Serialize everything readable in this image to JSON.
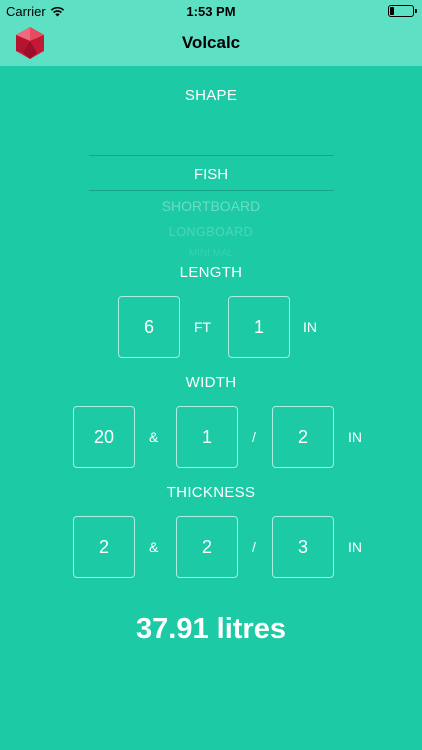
{
  "status_bar": {
    "carrier": "Carrier",
    "time": "1:53 PM",
    "battery_level": 0.2
  },
  "nav": {
    "title": "Volcalc"
  },
  "shape": {
    "label": "SHAPE",
    "selected": "FISH",
    "options": [
      "SHORTBOARD",
      "LONGBOARD",
      "MINI MAL"
    ]
  },
  "length": {
    "label": "LENGTH",
    "feet": "6",
    "feet_unit": "FT",
    "inches": "1",
    "inches_unit": "IN"
  },
  "width": {
    "label": "WIDTH",
    "whole": "20",
    "and": "&",
    "numerator": "1",
    "slash": "/",
    "denominator": "2",
    "unit": "IN"
  },
  "thickness": {
    "label": "THICKNESS",
    "whole": "2",
    "and": "&",
    "numerator": "2",
    "slash": "/",
    "denominator": "3",
    "unit": "IN"
  },
  "result": {
    "text": "37.91 litres"
  },
  "colors": {
    "background": "#1ccaa5",
    "header": "#5ee0c4",
    "logo": "#d21f3c"
  }
}
